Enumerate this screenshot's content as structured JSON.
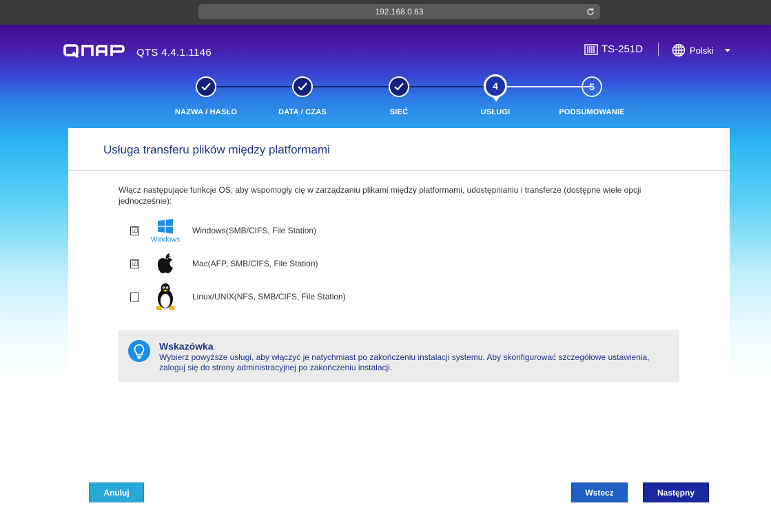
{
  "browser": {
    "url": "192.168.0.63"
  },
  "header": {
    "logo": "QNAP",
    "version": "QTS 4.4.1.1146",
    "device": "TS-251D",
    "language": "Polski"
  },
  "steps": [
    {
      "number": "1",
      "label": "NAZWA / HASŁO",
      "state": "done"
    },
    {
      "number": "2",
      "label": "DATA / CZAS",
      "state": "done"
    },
    {
      "number": "3",
      "label": "SIEĆ",
      "state": "done"
    },
    {
      "number": "4",
      "label": "USŁUGI",
      "state": "active"
    },
    {
      "number": "5",
      "label": "PODSUMOWANIE",
      "state": "future"
    }
  ],
  "main": {
    "title": "Usługa transferu plików między platformami",
    "intro": "Włącz następujące funkcje OS, aby wspomogły cię w zarządzaniu plikami między platformami, udostępnianiu i transferze (dostępne wiele opcji jednocześnie):",
    "options": [
      {
        "icon": "windows-logo-icon",
        "icon_text": "Windows",
        "label": "Windows(SMB/CIFS, File Station)",
        "checked": true
      },
      {
        "icon": "apple-logo-icon",
        "label": "Mac(AFP, SMB/CIFS, File Station)",
        "checked": true
      },
      {
        "icon": "linux-penguin-icon",
        "label": "Linux/UNIX(NFS, SMB/CIFS, File Station)",
        "checked": false
      }
    ],
    "tip": {
      "title": "Wskazówka",
      "text": "Wybierz powyższe usługi, aby włączyć je natychmiast po zakończeniu instalacji systemu. Aby skonfigurować szczegółowe ustawienia, zaloguj się do strony administracyjnej po zakończeniu instalacji."
    }
  },
  "buttons": {
    "cancel": "Anuluj",
    "back": "Wstecz",
    "next": "Następny"
  },
  "colors": {
    "accent_dark": "#1b29a0",
    "accent_blue": "#1f5fc4",
    "cancel_teal": "#29a8d8",
    "title_blue": "#1f3784"
  }
}
